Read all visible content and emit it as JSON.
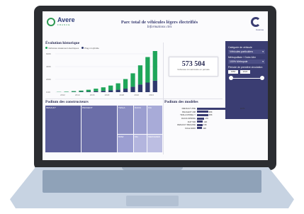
{
  "header": {
    "logo_left": "Avere",
    "logo_left_sub": "FRANCE",
    "title": "Parc total de véhicules légers électrifiés",
    "subtitle": "Informations clés",
    "logo_right_label": "Cosmos"
  },
  "history": {
    "title": "Évolution historique",
    "legend": [
      "Véhicules totalement électriques",
      "Plug-in Hybride"
    ],
    "colors": {
      "ev": "#1fa65a",
      "phev": "#2f3a6e"
    },
    "y_ticks": [
      "600K",
      "400K",
      "200K",
      "0.0K"
    ],
    "x_ticks": [
      "2012",
      "2014",
      "2016",
      "2018",
      "2020",
      "2022",
      "2024"
    ]
  },
  "chart_data": {
    "type": "bar",
    "categories": [
      "2011",
      "2012",
      "2013",
      "2014",
      "2015",
      "2016",
      "2017",
      "2018",
      "2019",
      "2020",
      "2021",
      "2022",
      "2023",
      "2024"
    ],
    "series": [
      {
        "name": "Véhicules totalement électriques",
        "values": [
          3,
          6,
          12,
          18,
          28,
          40,
          55,
          75,
          100,
          150,
          210,
          300,
          400,
          480
        ]
      },
      {
        "name": "Plug-in Hybride",
        "values": [
          1,
          2,
          4,
          6,
          9,
          14,
          20,
          28,
          38,
          55,
          85,
          120,
          150,
          180
        ]
      }
    ],
    "ylim": [
      0,
      600
    ]
  },
  "kpi": {
    "value": "573 504",
    "label": "Véhicules immatriculés en période"
  },
  "filters": {
    "vehicle_label": "Catégorie de véhicule",
    "vehicle_value": "Véhicules particuliers",
    "region_label": "Métropolitain / Outre-Mer",
    "region_value": "100% Métropole",
    "period_label": "Période de première circulation",
    "year_from": "1950",
    "year_to": "2024"
  },
  "constructors": {
    "title": "Podium des constructeurs",
    "blocks": [
      {
        "label": "RENAULT",
        "color": "#5a5d98"
      },
      {
        "label": "PEUGEOT",
        "color": "#6b6ea8"
      },
      {
        "label": "TESLA",
        "color": "#8a8dc2"
      },
      {
        "label": "DACIA",
        "color": "#9b9ed0"
      },
      {
        "label": "KIA",
        "color": "#a8abd8"
      },
      {
        "label": "BMW",
        "color": "#9c9fd2"
      },
      {
        "label": "MG",
        "color": "#b3b5de"
      },
      {
        "label": "MERCEDES",
        "color": "#bcbee2"
      }
    ]
  },
  "models": {
    "title": "Podium des modèles",
    "bar_color": "#3a3d72",
    "rows": [
      {
        "label": "RENAULT ZOE",
        "value": "107K",
        "share": 1.0
      },
      {
        "label": "PEUGEOT 208",
        "value": "28K",
        "share": 0.26
      },
      {
        "label": "TESLA MODEL Y",
        "value": "28K",
        "share": 0.26
      },
      {
        "label": "DACIA SPRING",
        "value": "17K",
        "share": 0.17
      },
      {
        "label": "FIAT 500",
        "value": "14K",
        "share": 0.14
      },
      {
        "label": "RENAULT MEGANE",
        "value": "13K",
        "share": 0.13
      },
      {
        "label": "KIA E-NIRO",
        "value": "12K",
        "share": 0.12
      }
    ]
  }
}
